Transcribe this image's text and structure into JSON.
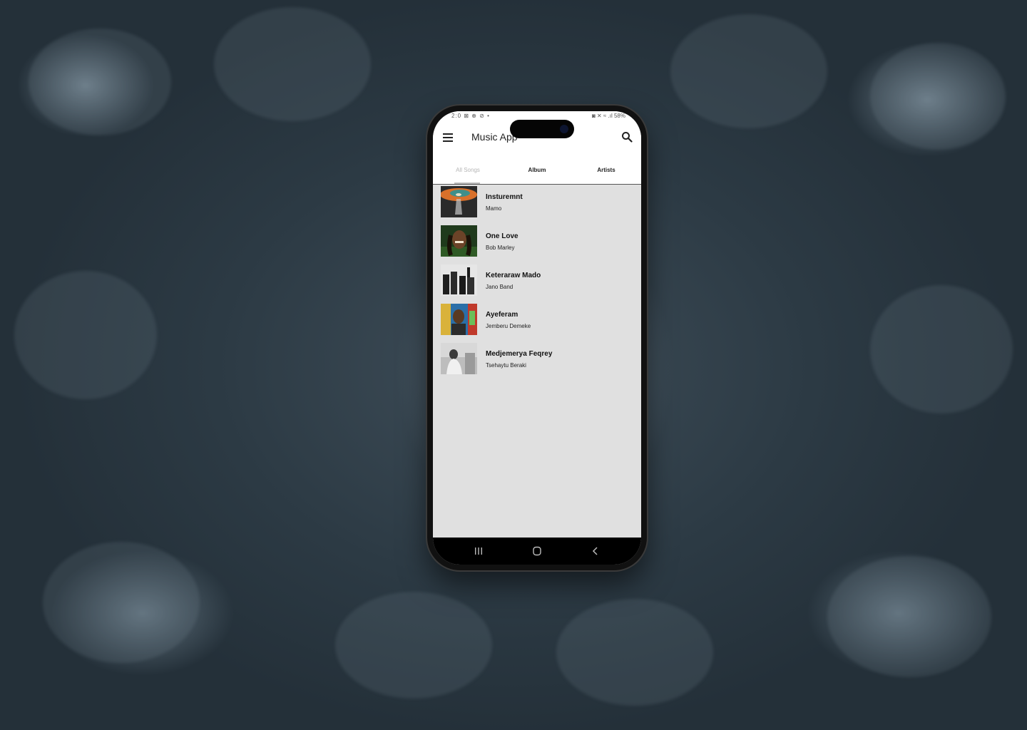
{
  "app": {
    "title": "Music App"
  },
  "status_bar": {
    "left": "2:0 ⊠ ⊕ ⊘ •",
    "right": "◙ ✕ ≈ .ıl 58%"
  },
  "tabs": [
    {
      "label": "All Songs",
      "selected": true
    },
    {
      "label": "Album",
      "selected": false
    },
    {
      "label": "Artists",
      "selected": false
    }
  ],
  "songs": [
    {
      "title": "Insturemnt",
      "artist": "Mamo"
    },
    {
      "title": "One Love",
      "artist": "Bob Marley"
    },
    {
      "title": "Keteraraw Mado",
      "artist": "Jano Band"
    },
    {
      "title": "Ayeferam",
      "artist": "Jemberu Demeke"
    },
    {
      "title": "Medjemerya Feqrey",
      "artist": "Tsehaytu Beraki"
    }
  ],
  "icons": {
    "menu": "menu-icon",
    "search": "search-icon",
    "nav_recents": "recents-icon",
    "nav_home": "home-icon",
    "nav_back": "back-icon"
  },
  "colors": {
    "screen_background": "#e0e0e0",
    "appbar_background": "#ffffff",
    "navbar_background": "#000000",
    "inactive_tab": "#b5b5b5"
  }
}
